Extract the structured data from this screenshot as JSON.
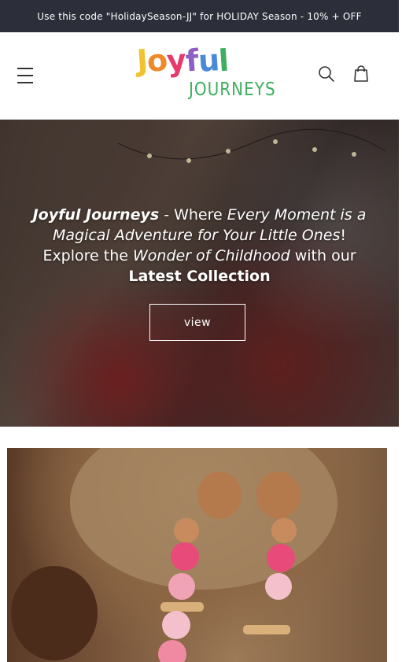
{
  "announcement": {
    "text": "Use this code \"HolidaySeason-JJ\" for HOLIDAY Season - 10% + OFF"
  },
  "header": {
    "logo_top": "Joyful",
    "logo_bottom": "JOURNEYS",
    "menu_icon": "hamburger-menu-icon",
    "search_icon": "search-icon",
    "cart_icon": "cart-icon"
  },
  "hero": {
    "part1": "Joyful Journeys",
    "part2": " - Where ",
    "part3": "Every Moment is a Magical Adventure for Your Little Ones",
    "part4": "! Explore the ",
    "part5": "Wonder of Childhood",
    "part6": " with our ",
    "part7": "Latest Collection",
    "button_label": "view"
  },
  "colors": {
    "announcement_bg": "#2c2f3a",
    "logo_green": "#3fae5f",
    "logo_letters": [
      "#f2c230",
      "#ef8a2a",
      "#e63a6a",
      "#8e5fc5",
      "#4a8bd8",
      "#f2c230"
    ]
  }
}
